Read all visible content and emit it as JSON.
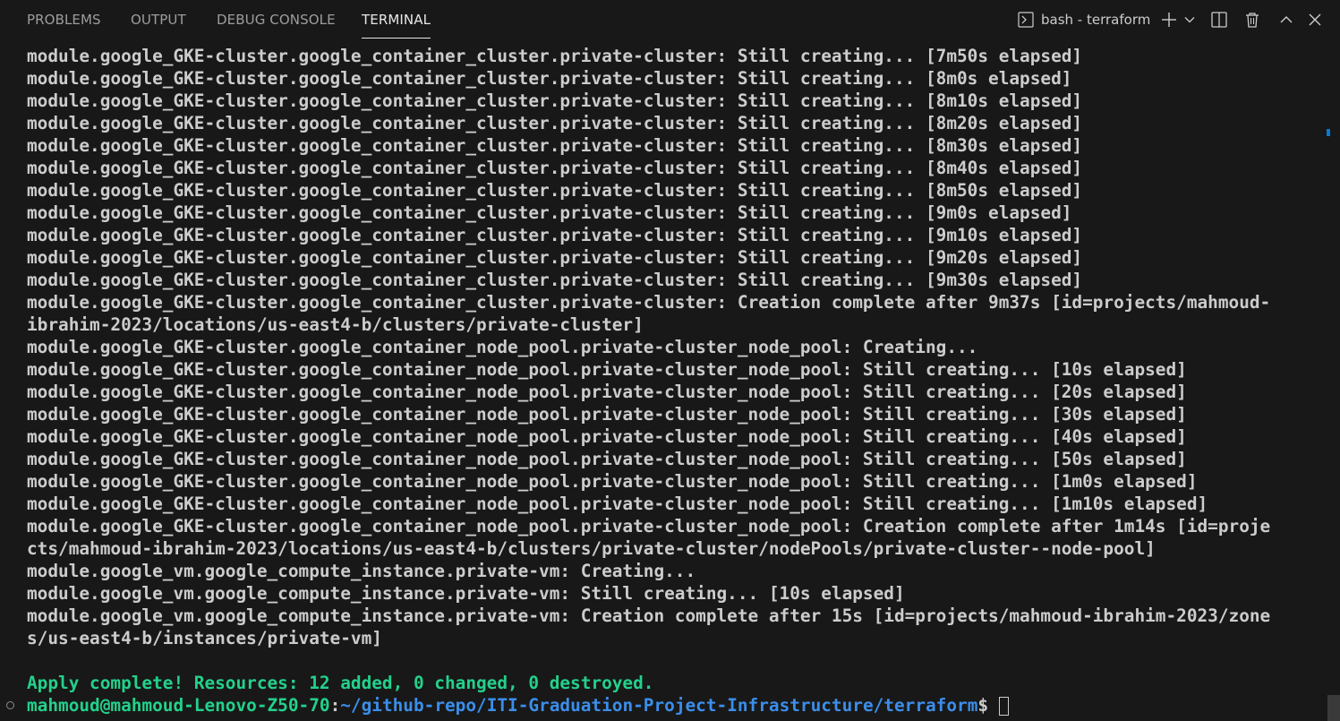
{
  "tabs": [
    {
      "label": "PROBLEMS"
    },
    {
      "label": "OUTPUT"
    },
    {
      "label": "DEBUG CONSOLE"
    },
    {
      "label": "TERMINAL"
    }
  ],
  "terminal_name": "bash - terraform",
  "lines": [
    "module.google_GKE-cluster.google_container_cluster.private-cluster: Still creating... [7m50s elapsed]",
    "module.google_GKE-cluster.google_container_cluster.private-cluster: Still creating... [8m0s elapsed]",
    "module.google_GKE-cluster.google_container_cluster.private-cluster: Still creating... [8m10s elapsed]",
    "module.google_GKE-cluster.google_container_cluster.private-cluster: Still creating... [8m20s elapsed]",
    "module.google_GKE-cluster.google_container_cluster.private-cluster: Still creating... [8m30s elapsed]",
    "module.google_GKE-cluster.google_container_cluster.private-cluster: Still creating... [8m40s elapsed]",
    "module.google_GKE-cluster.google_container_cluster.private-cluster: Still creating... [8m50s elapsed]",
    "module.google_GKE-cluster.google_container_cluster.private-cluster: Still creating... [9m0s elapsed]",
    "module.google_GKE-cluster.google_container_cluster.private-cluster: Still creating... [9m10s elapsed]",
    "module.google_GKE-cluster.google_container_cluster.private-cluster: Still creating... [9m20s elapsed]",
    "module.google_GKE-cluster.google_container_cluster.private-cluster: Still creating... [9m30s elapsed]",
    "module.google_GKE-cluster.google_container_cluster.private-cluster: Creation complete after 9m37s [id=projects/mahmoud-",
    "ibrahim-2023/locations/us-east4-b/clusters/private-cluster]",
    "module.google_GKE-cluster.google_container_node_pool.private-cluster_node_pool: Creating...",
    "module.google_GKE-cluster.google_container_node_pool.private-cluster_node_pool: Still creating... [10s elapsed]",
    "module.google_GKE-cluster.google_container_node_pool.private-cluster_node_pool: Still creating... [20s elapsed]",
    "module.google_GKE-cluster.google_container_node_pool.private-cluster_node_pool: Still creating... [30s elapsed]",
    "module.google_GKE-cluster.google_container_node_pool.private-cluster_node_pool: Still creating... [40s elapsed]",
    "module.google_GKE-cluster.google_container_node_pool.private-cluster_node_pool: Still creating... [50s elapsed]",
    "module.google_GKE-cluster.google_container_node_pool.private-cluster_node_pool: Still creating... [1m0s elapsed]",
    "module.google_GKE-cluster.google_container_node_pool.private-cluster_node_pool: Still creating... [1m10s elapsed]",
    "module.google_GKE-cluster.google_container_node_pool.private-cluster_node_pool: Creation complete after 1m14s [id=proje",
    "cts/mahmoud-ibrahim-2023/locations/us-east4-b/clusters/private-cluster/nodePools/private-cluster--node-pool]",
    "module.google_vm.google_compute_instance.private-vm: Creating...",
    "module.google_vm.google_compute_instance.private-vm: Still creating... [10s elapsed]",
    "module.google_vm.google_compute_instance.private-vm: Creation complete after 15s [id=projects/mahmoud-ibrahim-2023/zone",
    "s/us-east4-b/instances/private-vm]",
    ""
  ],
  "apply_summary": "Apply complete! Resources: 12 added, 0 changed, 0 destroyed.",
  "prompt": {
    "user_host": "mahmoud@mahmoud-Lenovo-Z50-70",
    "separator": ":",
    "path": "~/github-repo/ITI-Graduation-Project-Infrastructure/terraform",
    "symbol": "$ "
  },
  "colors": {
    "background": "#181818",
    "text": "#cccccc",
    "success_green": "#23d18b",
    "path_blue": "#3b8eea",
    "accent_blue": "#0a7ad0"
  },
  "icons": {
    "terminal": "terminal-icon",
    "add": "plus-icon",
    "dropdown": "chevron-down-icon",
    "split": "split-terminal-icon",
    "kill": "trash-icon",
    "maximize": "chevron-up-icon",
    "close": "close-icon"
  }
}
